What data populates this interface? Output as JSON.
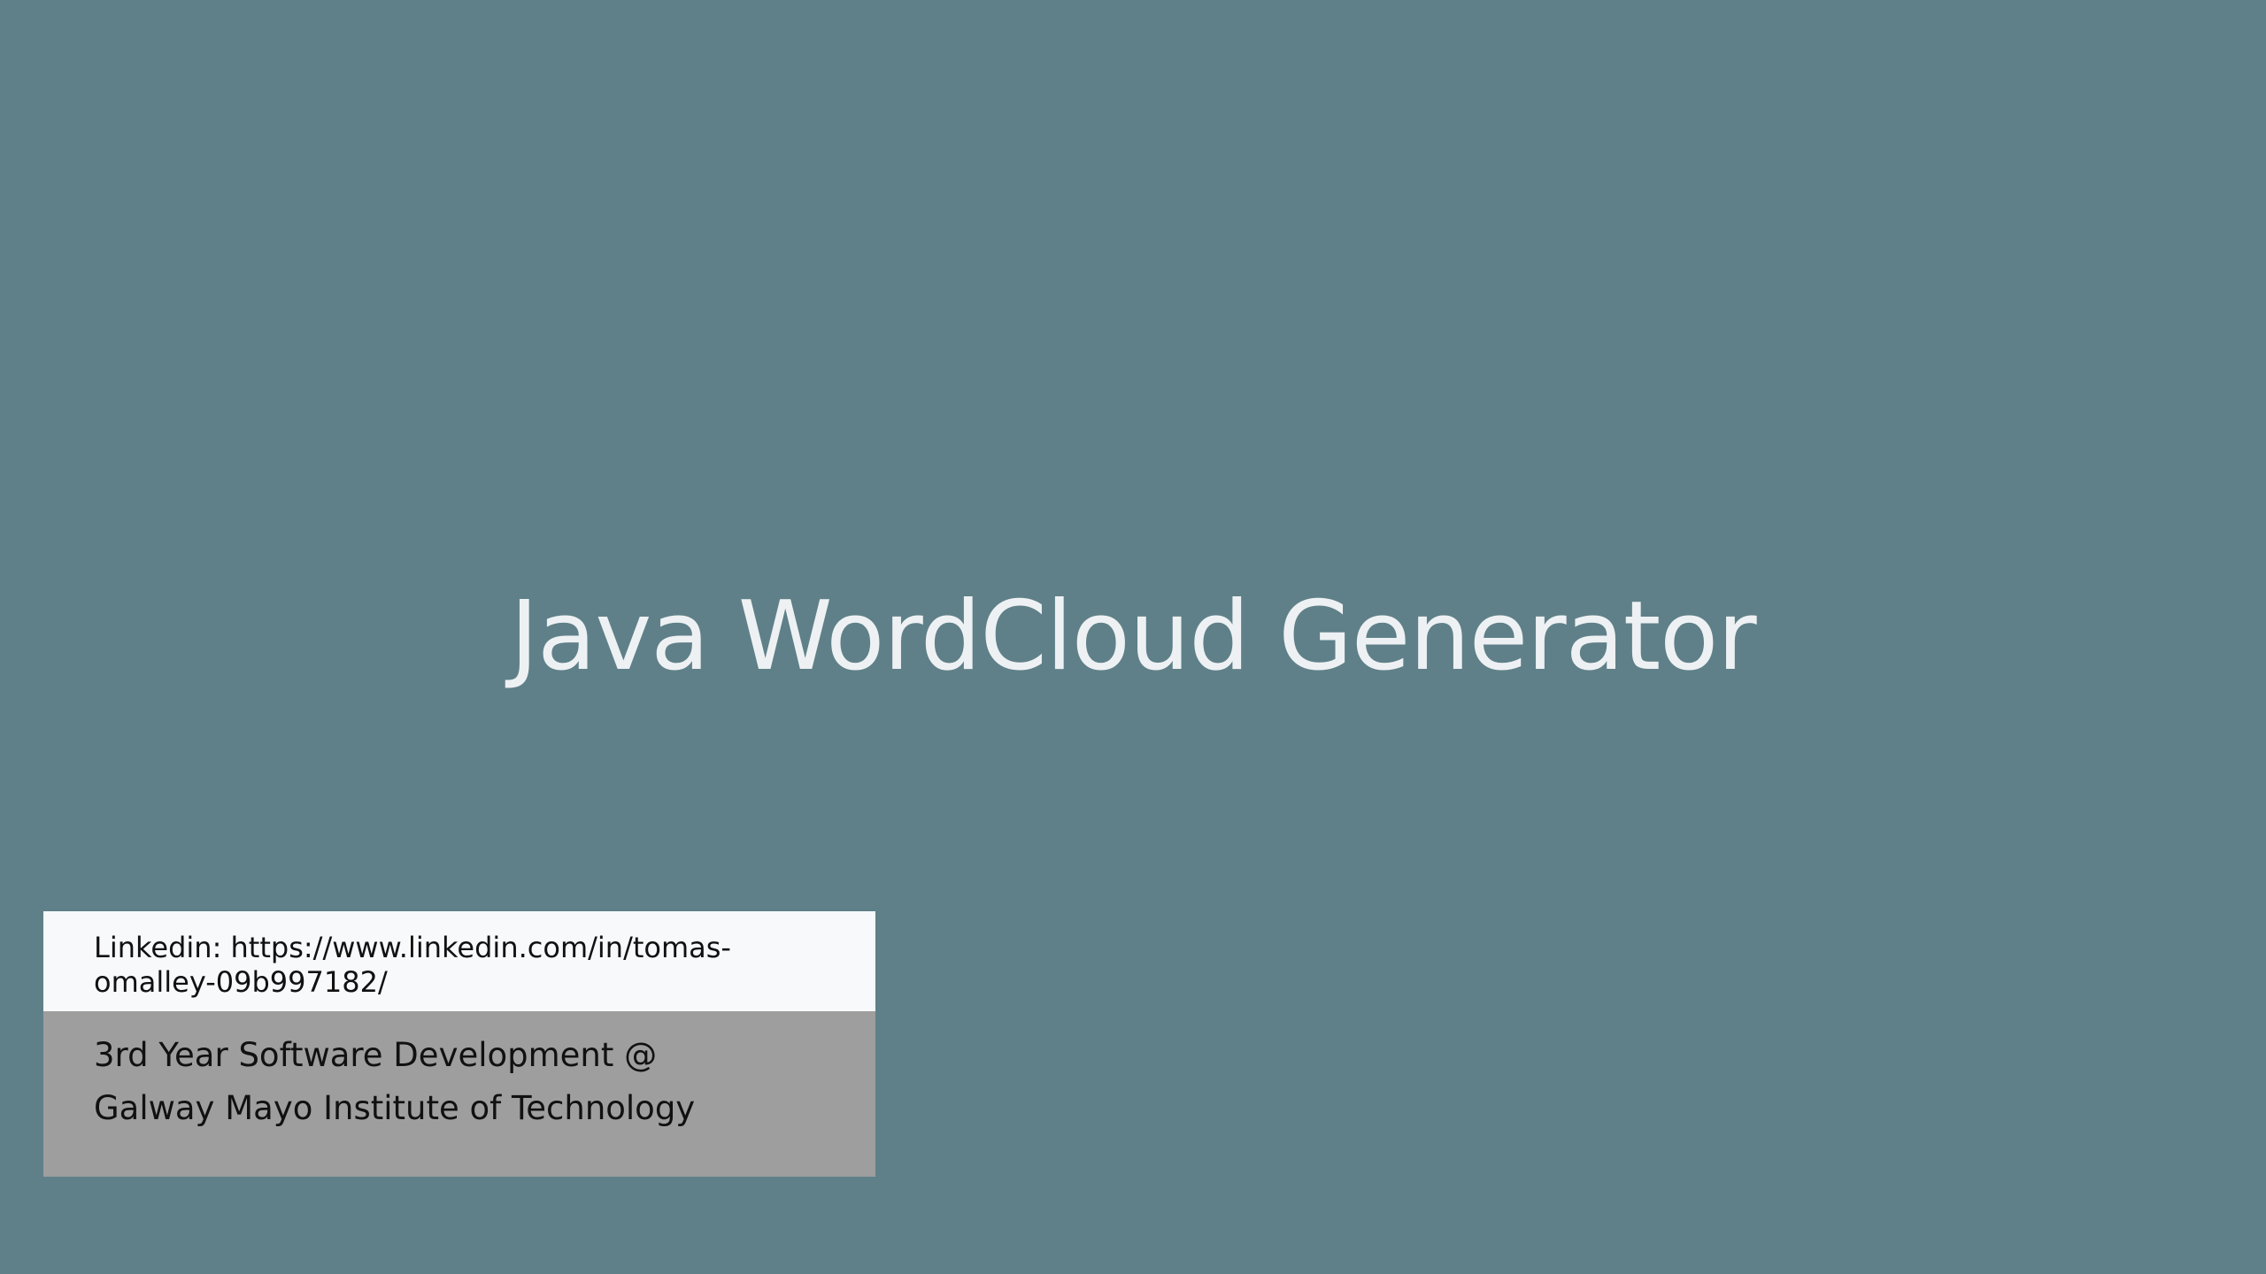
{
  "slide": {
    "title": "Java WordCloud Generator",
    "background_color": "#5f8088",
    "title_color": "#eef1f3"
  },
  "info_card": {
    "link_line_1": "Linkedin: https://www.linkedin.com/in/tomas-",
    "link_line_2": "omalley-09b997182/",
    "link_box_color": "#f8f9fb",
    "college_line_1": "3rd Year Software Development @",
    "college_line_2": "Galway Mayo Institute of Technology",
    "college_box_color": "#9e9e9e"
  }
}
